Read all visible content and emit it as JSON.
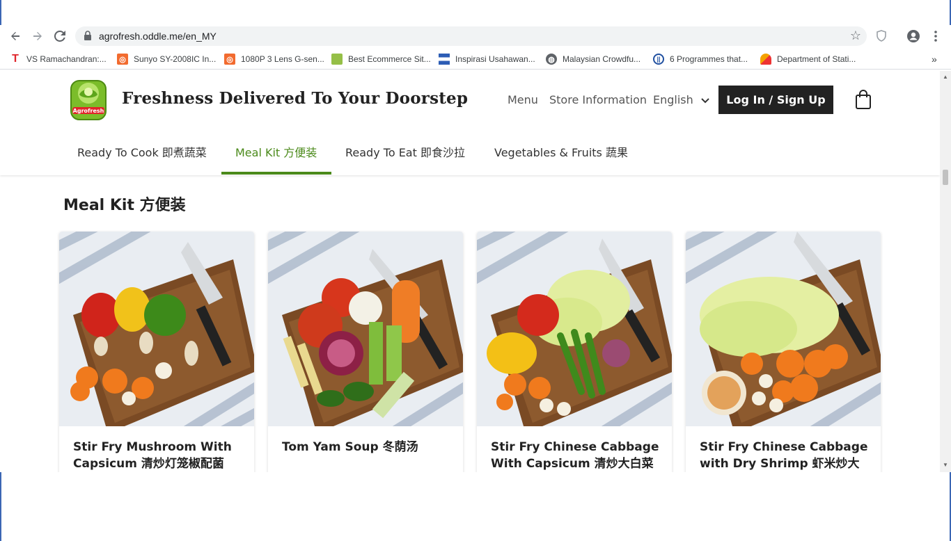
{
  "browser": {
    "url": "agrofresh.oddle.me/en_MY",
    "bookmarks": [
      {
        "label": "VS Ramachandran:...",
        "icon": "t-favicon"
      },
      {
        "label": "Sunyo SY-2008IC In...",
        "icon": "aliexpress-favicon"
      },
      {
        "label": "1080P 3 Lens G-sen...",
        "icon": "aliexpress-favicon"
      },
      {
        "label": "Best Ecommerce Sit...",
        "icon": "shopify-favicon"
      },
      {
        "label": "Inspirasi Usahawan...",
        "icon": "flag-favicon"
      },
      {
        "label": "Malaysian Crowdfu...",
        "icon": "globe-favicon"
      },
      {
        "label": "6 Programmes that...",
        "icon": "circle-favicon"
      },
      {
        "label": "Department of Stati...",
        "icon": "dosm-favicon"
      }
    ],
    "overflow": "»"
  },
  "site": {
    "tagline": "Freshness Delivered To Your Doorstep",
    "logo_text": "Agrofresh",
    "nav": {
      "menu": "Menu",
      "store_info": "Store Information",
      "language": "English",
      "login": "Log In / Sign Up"
    },
    "categories": [
      {
        "label": "Ready To Cook 即煮蔬菜",
        "active": false
      },
      {
        "label": "Meal Kit 方便装",
        "active": true
      },
      {
        "label": "Ready To Eat 即食沙拉",
        "active": false
      },
      {
        "label": "Vegetables & Fruits 蔬果",
        "active": false
      }
    ],
    "accent_color": "#4b8a1b"
  },
  "section": {
    "title": "Meal Kit 方便装",
    "products": [
      {
        "name": "Stir Fry Mushroom With Capsicum 清炒灯笼椒配菌"
      },
      {
        "name": "Tom Yam Soup 冬荫汤"
      },
      {
        "name": "Stir Fry Chinese Cabbage With Capsicum 清炒大白菜"
      },
      {
        "name": "Stir Fry Chinese Cabbage with Dry Shrimp 虾米炒大白"
      }
    ]
  }
}
